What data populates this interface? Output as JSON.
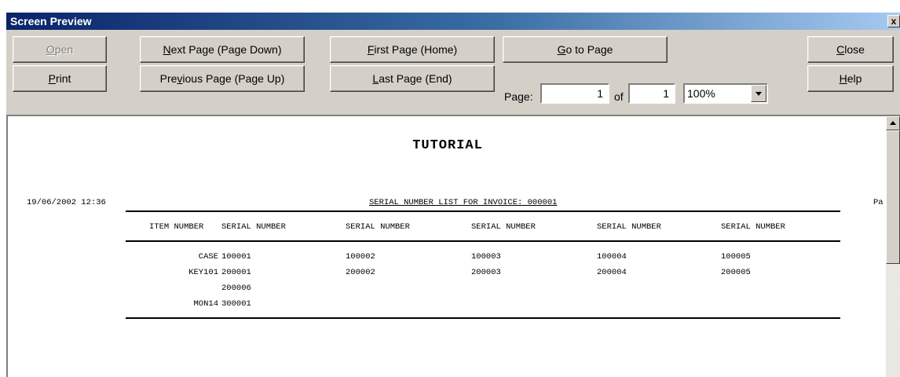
{
  "window": {
    "title": "Screen Preview",
    "close_glyph": "x"
  },
  "toolbar": {
    "open": {
      "pre": "",
      "accel": "O",
      "post": "pen"
    },
    "print": {
      "pre": "",
      "accel": "P",
      "post": "rint"
    },
    "next_page": {
      "pre": "",
      "accel": "N",
      "post": "ext Page (Page Down)"
    },
    "prev_page": {
      "pre": "Pre",
      "accel": "v",
      "post": "ious Page (Page Up)"
    },
    "first_page": {
      "pre": "",
      "accel": "F",
      "post": "irst Page (Home)"
    },
    "last_page": {
      "pre": "",
      "accel": "L",
      "post": "ast Page (End)"
    },
    "goto_page": {
      "pre": "",
      "accel": "G",
      "post": "o to Page"
    },
    "close": {
      "pre": "",
      "accel": "C",
      "post": "lose"
    },
    "help": {
      "pre": "",
      "accel": "H",
      "post": "elp"
    },
    "page_label": "Page:",
    "page_value": "1",
    "of_label": "of",
    "total_value": "1",
    "zoom": "100%"
  },
  "report": {
    "title": "TUTORIAL",
    "datetime": "19/06/2002 12:36",
    "subtitle": "SERIAL NUMBER LIST FOR INVOICE: 000001",
    "page_fragment": "Pa",
    "headers": [
      "ITEM NUMBER",
      "SERIAL NUMBER",
      "SERIAL NUMBER",
      "SERIAL NUMBER",
      "SERIAL NUMBER",
      "SERIAL NUMBER"
    ],
    "rows": [
      [
        "CASE",
        "100001",
        "100002",
        "100003",
        "100004",
        "100005"
      ],
      [
        "KEY101",
        "200001",
        "200002",
        "200003",
        "200004",
        "200005"
      ],
      [
        "",
        "200006",
        "",
        "",
        "",
        ""
      ],
      [
        "MON14",
        "300001",
        "",
        "",
        "",
        ""
      ]
    ]
  }
}
